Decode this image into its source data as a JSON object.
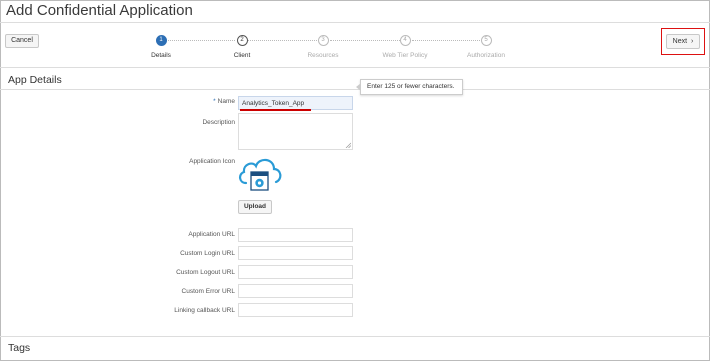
{
  "page": {
    "title": "Add Confidential Application"
  },
  "toolbar": {
    "cancel_label": "Cancel",
    "next_label": "Next"
  },
  "steps": [
    {
      "number": "1",
      "label": "Details"
    },
    {
      "number": "2",
      "label": "Client"
    },
    {
      "number": "3",
      "label": "Resources"
    },
    {
      "number": "4",
      "label": "Web Tier Policy"
    },
    {
      "number": "5",
      "label": "Authorization"
    }
  ],
  "app_details": {
    "heading": "App Details",
    "required_marker": "*",
    "name_label": "Name",
    "name_value": "Analytics_Token_App",
    "name_tooltip": "Enter 125 or fewer characters.",
    "description_label": "Description",
    "description_value": "",
    "icon_label": "Application Icon",
    "upload_label": "Upload",
    "fields": [
      {
        "label": "Application URL",
        "value": ""
      },
      {
        "label": "Custom Login URL",
        "value": ""
      },
      {
        "label": "Custom Logout URL",
        "value": ""
      },
      {
        "label": "Custom Error URL",
        "value": ""
      },
      {
        "label": "Linking callback URL",
        "value": ""
      }
    ]
  },
  "tags": {
    "heading": "Tags"
  },
  "colors": {
    "accent": "#2d6fb5",
    "highlight_red": "#d11111",
    "icon_blue": "#2a9bd6"
  }
}
